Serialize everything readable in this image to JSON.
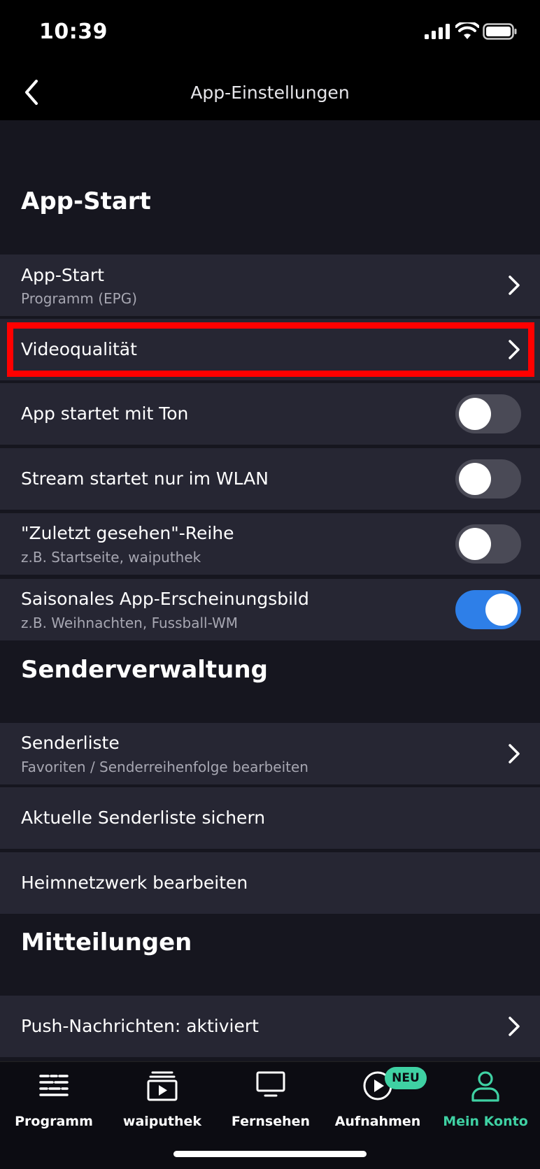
{
  "status": {
    "time": "10:39"
  },
  "nav": {
    "title": "App-Einstellungen"
  },
  "sections": {
    "app_start": {
      "title": "App-Start",
      "rows": {
        "app_start": {
          "title": "App-Start",
          "subtitle": "Programm (EPG)"
        },
        "video_quality": {
          "title": "Videoqualität"
        },
        "sound": {
          "title": "App startet mit Ton",
          "enabled": false
        },
        "wlan": {
          "title": "Stream startet nur im WLAN",
          "enabled": false
        },
        "recently": {
          "title": "\"Zuletzt gesehen\"-Reihe",
          "subtitle": "z.B. Startseite, waiputhek",
          "enabled": false
        },
        "seasonal": {
          "title": "Saisonales App-Erscheinungsbild",
          "subtitle": "z.B. Weihnachten, Fussball-WM",
          "enabled": true
        }
      }
    },
    "channels": {
      "title": "Senderverwaltung",
      "rows": {
        "list": {
          "title": "Senderliste",
          "subtitle": "Favoriten / Senderreihenfolge bearbeiten"
        },
        "backup": {
          "title": "Aktuelle Senderliste sichern"
        },
        "homenet": {
          "title": "Heimnetzwerk bearbeiten"
        }
      }
    },
    "notifications": {
      "title": "Mitteilungen",
      "rows": {
        "push": {
          "title": "Push-Nachrichten: aktiviert"
        }
      }
    }
  },
  "tabs": {
    "programm": "Programm",
    "waiputhek": "waiputhek",
    "fernsehen": "Fernsehen",
    "aufnahmen": "Aufnahmen",
    "konto": "Mein Konto",
    "badge": "NEU",
    "active": "konto"
  },
  "colors": {
    "accent": "#3fd1a3",
    "toggle_on": "#2e7fe8",
    "highlight": "#ff0000",
    "row_bg": "#262633",
    "page_bg": "#16161f"
  }
}
